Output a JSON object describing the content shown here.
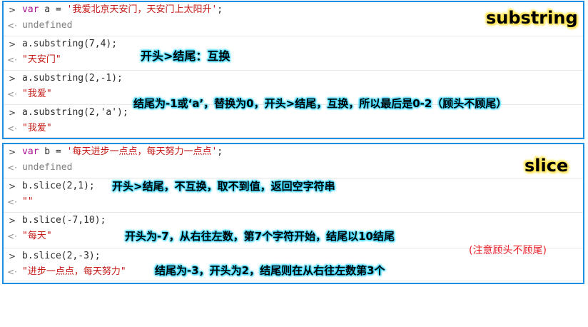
{
  "panel1": {
    "title": "substring",
    "rows": [
      {
        "prompt": "var a = '我爱北京天安门，天安门上太阳升';",
        "output": "undefined"
      },
      {
        "prompt": "a.substring(7,4);",
        "output": "\"天安门\""
      },
      {
        "prompt": "a.substring(2,-1);",
        "output": "\"我爱\""
      },
      {
        "prompt": "a.substring(2,'a');",
        "output": "\"我爱\""
      }
    ],
    "notes": {
      "swap": "开头>结尾：互换",
      "negative": "结尾为-1或‘a’，替换为0，开头>结尾，互换，所以最后是0-2（顾头不顾尾）"
    }
  },
  "panel2": {
    "title": "slice",
    "rows": [
      {
        "prompt": "var b = '每天进步一点点，每天努力一点点';",
        "output": "undefined"
      },
      {
        "prompt": "b.slice(2,1);",
        "output": "\"\""
      },
      {
        "prompt": "b.slice(-7,10);",
        "output": "\"每天\""
      },
      {
        "prompt": "b.slice(2,-3);",
        "output": "\"进步一点点，每天努力\""
      }
    ],
    "notes": {
      "noswap": "开头>结尾，不互换，取不到值，返回空字符串",
      "negstart": "开头为-7，从右往左数，第7个字符开始，结尾以10结尾",
      "negend": "结尾为-3，开头为2，结尾则在从右往左数第3个",
      "reminder": "(注意顾头不顾尾)"
    }
  },
  "icons": {
    "input": "chevron-right-icon",
    "output": "return-arrow-icon"
  },
  "colors": {
    "border": "#1e8fe0",
    "keyword": "#aa0d91",
    "string": "#c41a16",
    "undefined": "#7f7f7f",
    "highlight_blue": "#37d7ff",
    "highlight_yellow": "#ffe44a",
    "red_note": "#e8202a"
  }
}
